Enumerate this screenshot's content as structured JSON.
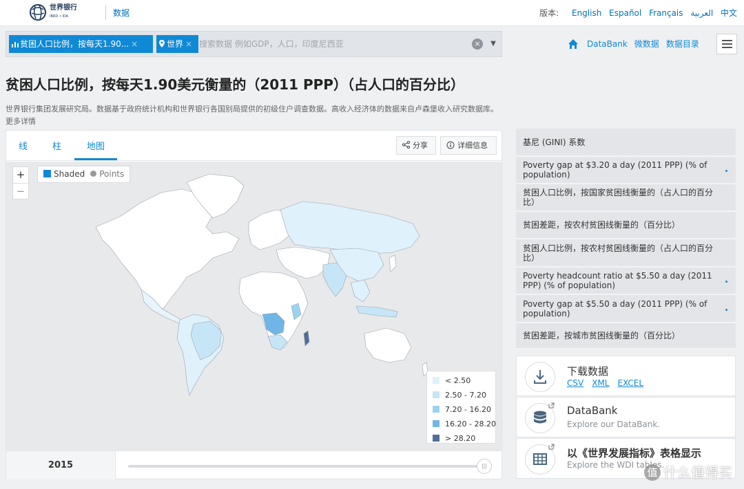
{
  "brand": {
    "logo_text": "世界银行",
    "logo_sub": "IBRD • IDA",
    "section": "数据"
  },
  "languages": {
    "label": "版本:",
    "items": [
      "English",
      "Español",
      "Français",
      "العربية",
      "中文"
    ]
  },
  "search": {
    "chips": [
      {
        "label": "贫困人口比例，按每天1.90..."
      },
      {
        "label": "世界"
      }
    ],
    "chip_close": "×",
    "placeholder": "搜索数据 例如GDP，人口，印度尼西亚"
  },
  "nav": {
    "items": [
      "DataBank",
      "微数据",
      "数据目录"
    ]
  },
  "page": {
    "title": "贫困人口比例，按每天1.90美元衡量的（2011 PPP）（占人口的百分比）",
    "description": "世界银行集团发展研究局。数据基于政府统计机构和世界银行各国别局提供的初级住户调查数据。高收入经济体的数据来自卢森堡收入研究数据库。更多详情"
  },
  "chart": {
    "tabs": [
      "线",
      "柱",
      "地图"
    ],
    "active_tab": "地图",
    "share_label": "分享",
    "info_label": "详细信息",
    "zoom_in": "+",
    "zoom_out": "−",
    "mode_shaded": "Shaded",
    "mode_points": "Points",
    "legend": [
      {
        "label": "< 2.50",
        "color": "#dff1fb"
      },
      {
        "label": "2.50 - 7.20",
        "color": "#c6e6f8"
      },
      {
        "label": "7.20 - 16.20",
        "color": "#9ad3f1"
      },
      {
        "label": "16.20 - 28.20",
        "color": "#6fb6e6"
      },
      {
        "label": "> 28.20",
        "color": "#4f6f98"
      }
    ],
    "year": "2015",
    "slider_fraction": 0.97,
    "accent_color": "#0f89d6"
  },
  "related": [
    {
      "label": "基尼 (GINI) 系数",
      "dot": false
    },
    {
      "label": "Poverty gap at $3.20 a day (2011 PPP) (% of population)",
      "dot": true
    },
    {
      "label": "贫困人口比例，按国家贫困线衡量的（占人口的百分比）",
      "dot": false
    },
    {
      "label": "贫困差距，按农村贫困线衡量的（百分比）",
      "dot": false
    },
    {
      "label": "贫困人口比例，按农村贫困线衡量的（占人口的百分比）",
      "dot": false
    },
    {
      "label": "Poverty headcount ratio at $5.50 a day (2011 PPP) (% of population)",
      "dot": true
    },
    {
      "label": "Poverty gap at $5.50 a day (2011 PPP) (% of population)",
      "dot": true
    },
    {
      "label": "贫困差距，按城市贫困线衡量的（百分比）",
      "dot": false
    }
  ],
  "cards": {
    "download": {
      "title": "下载数据",
      "links": [
        "CSV",
        "XML",
        "EXCEL"
      ],
      "icon": "download-icon"
    },
    "databank": {
      "title": "DataBank",
      "subtitle": "Explore our DataBank.",
      "icon": "database-icon"
    },
    "wdi": {
      "title": "以《世界发展指标》表格显示",
      "subtitle": "Explore the WDI tables.",
      "icon": "table-icon"
    }
  },
  "watermark": {
    "badge": "值",
    "text": "什么值得买"
  }
}
